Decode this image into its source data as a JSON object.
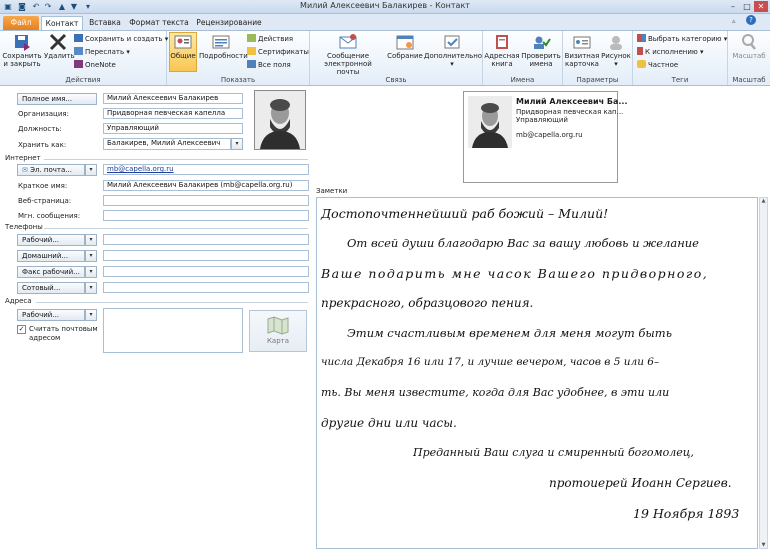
{
  "window": {
    "title": "Милий Алексеевич Балакирев - Контакт"
  },
  "quick_access": {
    "icons": [
      "save-icon",
      "undo-icon",
      "redo-icon",
      "up-arrow-icon",
      "down-arrow-icon",
      "customize-icon"
    ]
  },
  "tabs": [
    {
      "label": "Файл"
    },
    {
      "label": "Контакт"
    },
    {
      "label": "Вставка"
    },
    {
      "label": "Формат текста"
    },
    {
      "label": "Рецензирование"
    }
  ],
  "ribbon": {
    "actions": {
      "group_label": "Действия",
      "save_close": "Сохранить и закрыть",
      "delete": "Удалить",
      "save_new": "Сохранить и создать",
      "forward": "Переслать",
      "onenote": "OneNote"
    },
    "show": {
      "group_label": "Показать",
      "general": "Общие",
      "details": "Подробности",
      "activities": "Действия",
      "certificates": "Сертификаты",
      "all_fields": "Все поля"
    },
    "communicate": {
      "group_label": "Связь",
      "email": "Сообщение электронной почты",
      "meeting": "Собрание",
      "more": "Дополнительно"
    },
    "names": {
      "group_label": "Имена",
      "address_book": "Адресная книга",
      "check_names": "Проверить имена"
    },
    "options": {
      "group_label": "Параметры",
      "business_card": "Визитная карточка",
      "picture": "Рисунок"
    },
    "tags": {
      "group_label": "Теги",
      "categorize": "Выбрать категорию",
      "follow_up": "К исполнению",
      "private": "Частное"
    },
    "zoom": {
      "group_label": "Масштаб",
      "zoom": "Масштаб"
    }
  },
  "form": {
    "full_name_button": "Полное имя...",
    "full_name": "Милий Алексеевич Балакирев",
    "company_label": "Организация:",
    "company": "Придворная певческая капелла",
    "job_label": "Должность:",
    "job": "Управляющий",
    "file_as_label": "Хранить как:",
    "file_as": "Балакирев, Милий Алексеевич",
    "internet_section": "Интернет",
    "email_button": "Эл. почта...",
    "email": "mb@capella.org.ru",
    "display_label": "Краткое имя:",
    "display": "Милий Алексеевич Балакирев (mb@capella.org.ru)",
    "web_label": "Веб-страница:",
    "im_label": "Мгн. сообщения:",
    "phones_section": "Телефоны",
    "phone_work": "Рабочий...",
    "phone_home": "Домашний...",
    "phone_fax": "Факс рабочий...",
    "phone_mobile": "Сотовый...",
    "address_section": "Адреса",
    "address_button": "Рабочий...",
    "mailing_checkbox": "Считать почтовым адресом",
    "map_label": "Карта"
  },
  "card": {
    "name": "Милий Алексеевич Ба...",
    "company": "Придворная певческая кап...",
    "title": "Управляющий",
    "email": "mb@capella.org.ru"
  },
  "notes": {
    "label": "Заметки",
    "lines": [
      "Достопочтеннейший раб божий – Милий!",
      "От всей души благодарю Вас за вашу любовь и желание",
      "Ваше подарить мне часок Вашего придворного,",
      "прекрасного, образцового пения.",
      "Этим счастливым временем для меня могут быть",
      "числа Декабря 16 или 17, и лучше вечером, часов в 5 или 6–",
      "ть. Вы меня известите, когда для Вас удобнее, в эти или",
      "другие дни или часы.",
      "Преданный Ваш слуга и смиренный богомолец,",
      "протоиерей Иоанн Сергиев.",
      "19 Ноября 1893"
    ]
  }
}
